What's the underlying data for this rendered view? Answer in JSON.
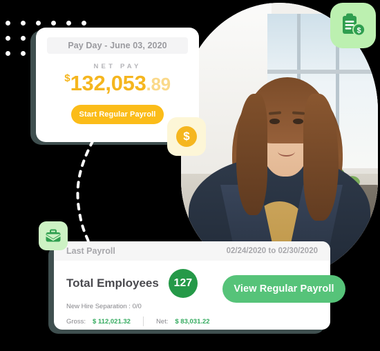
{
  "decor": {
    "dot_count": 18,
    "dot_color": "#ffffff",
    "connector_style": "dashed-curve"
  },
  "colors": {
    "background": "#000000",
    "card_shell": "#3f4f4f",
    "amber": "#fbbc19",
    "amber_light": "#fad98a",
    "green_primary": "#259948",
    "green_button": "#56c379",
    "green_badge_bg": "#bcf0b0",
    "green_money": "#33aa5e",
    "yellow_badge_bg": "#fdf6d7"
  },
  "pay_card": {
    "header_label": "Pay Day - June 03, 2020",
    "net_pay_label": "NET PAY",
    "currency_symbol": "$",
    "amount_whole": "132,053",
    "amount_cents": ".89",
    "start_button_label": "Start Regular Payroll"
  },
  "coin_badge": {
    "icon": "dollar-coin-icon",
    "symbol": "$"
  },
  "clipboard_badge": {
    "icon": "clipboard-money-icon"
  },
  "briefcase_badge": {
    "icon": "briefcase-icon"
  },
  "last_payroll_card": {
    "title": "Last Payroll",
    "date_range": "02/24/2020 to 02/30/2020",
    "total_employees_label": "Total Employees",
    "total_employees_count": "127",
    "new_hire_separation": "New Hire Separation : 0/0",
    "gross_label": "Gross:",
    "gross_value": "$ 112,021.32",
    "net_label": "Net:",
    "net_value": "$ 83,031.22"
  },
  "view_button": {
    "label": "View Regular Payroll"
  },
  "photo": {
    "alt": "smiling-woman-in-office-portrait"
  }
}
